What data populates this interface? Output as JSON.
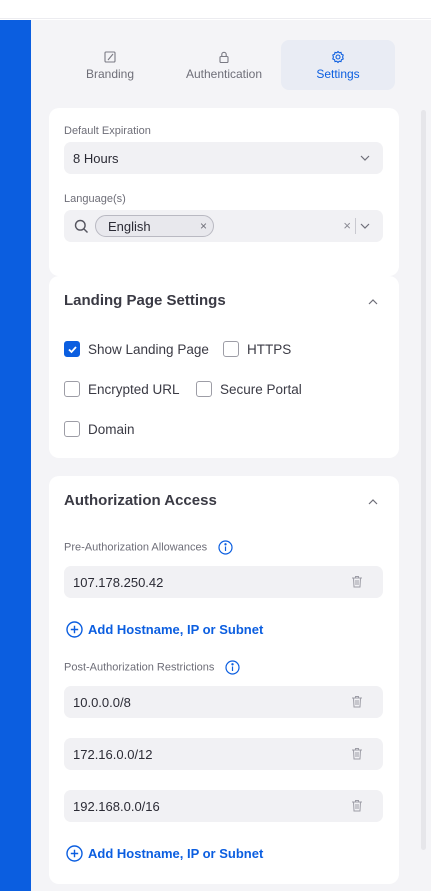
{
  "tabs": [
    {
      "label": "Branding",
      "icon": "brush-icon"
    },
    {
      "label": "Authentication",
      "icon": "lock-icon"
    },
    {
      "label": "Settings",
      "icon": "gear-icon"
    }
  ],
  "expiration": {
    "label": "Default Expiration",
    "value": "8 Hours"
  },
  "languages": {
    "label": "Language(s)",
    "chip": "English",
    "chip_remove": "×",
    "clear": "×"
  },
  "landing": {
    "title": "Landing Page Settings",
    "options": [
      {
        "label": "Show Landing Page",
        "checked": true
      },
      {
        "label": "HTTPS",
        "checked": false
      },
      {
        "label": "Encrypted URL",
        "checked": false
      },
      {
        "label": "Secure Portal",
        "checked": false
      },
      {
        "label": "Domain",
        "checked": false
      }
    ]
  },
  "authorization": {
    "title": "Authorization Access",
    "pre_label": "Pre-Authorization Allowances",
    "pre_entries": [
      "107.178.250.42"
    ],
    "post_label": "Post-Authorization Restrictions",
    "post_entries": [
      "10.0.0.0/8",
      "172.16.0.0/12",
      "192.168.0.0/16"
    ],
    "add_label": "Add Hostname, IP or Subnet"
  },
  "colors": {
    "accent": "#0b5ee0",
    "sidebar": "#0b5ee0",
    "background": "#f4f4f7"
  }
}
